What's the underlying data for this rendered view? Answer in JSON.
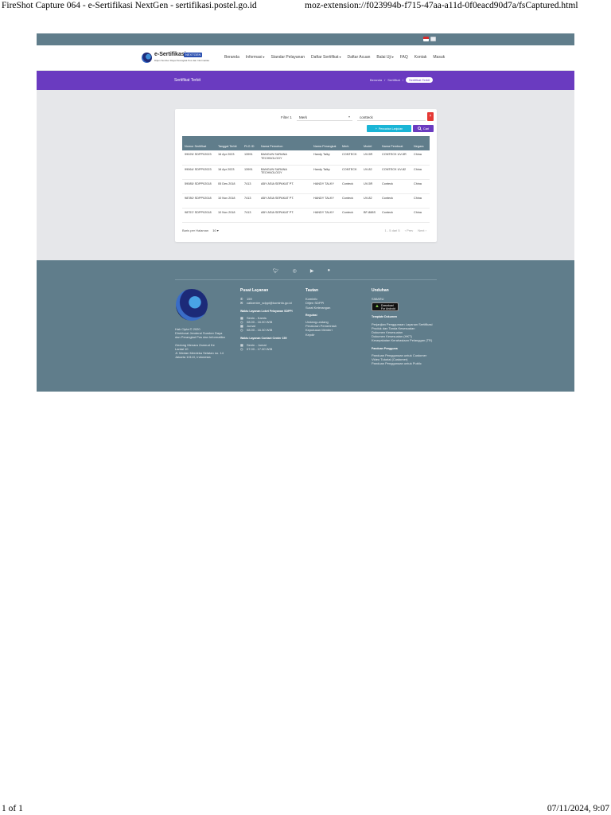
{
  "print_header": {
    "left": "FireShot Capture 064 - e-Sertifikasi NextGen - sertifikasi.postel.go.id",
    "right": "moz-extension://f023994b-f715-47aa-a11d-0f0eacd90d7a/fsCaptured.html"
  },
  "print_footer": {
    "left": "1 of 1",
    "right": "07/11/2024, 9:07"
  },
  "logo": {
    "title": "e-Sertifikasi",
    "badge": "NEXTGEN",
    "subtitle": "Ditjen Sumber Daya Perangkat Pos dan Informatika"
  },
  "nav": {
    "items": [
      {
        "label": "Beranda"
      },
      {
        "label": "Informasi",
        "dropdown": true
      },
      {
        "label": "Standar Pelayanan"
      },
      {
        "label": "Daftar Sertifikat",
        "dropdown": true
      },
      {
        "label": "Daftar Acuan"
      },
      {
        "label": "Balai Uji",
        "dropdown": true
      },
      {
        "label": "FAQ"
      },
      {
        "label": "Kontak"
      },
      {
        "label": "Masuk"
      }
    ]
  },
  "banner": {
    "title": "Sertifikat Terbit",
    "breadcrumbs": [
      "Beranda",
      "Sertifikat",
      "Sertifikat Terbit"
    ],
    "separator": "/"
  },
  "filter": {
    "label": "Filter 1",
    "field": "Merk",
    "search_value": "contteck",
    "clear_label": "×",
    "advanced_label": "Pencarian Lanjutan",
    "search_label": "Cari"
  },
  "table": {
    "headers": [
      "Nomor Sertifikat",
      "Tanggal Terbit",
      "PLG ID",
      "Nama Pemohon",
      "Nama Perangkat",
      "Merk",
      "Model",
      "Nama Pembuat",
      "Negara"
    ],
    "rows": [
      [
        "99025/ SDPPI/2023",
        "16 Apr 2023",
        "13991",
        "BANGUN SARANA TECHNOLOGY",
        "Handy Talky",
        "CONTECK",
        "UV-5R",
        "CONTECK UV-5R",
        "China"
      ],
      [
        "99064/ SDPPI/2023",
        "16 Apr 2023",
        "13991",
        "BANGUN SARANA TECHNOLOGY",
        "Handy Talky",
        "CONTECK",
        "UV-82",
        "CONTECK UV-82",
        "China"
      ],
      [
        "59085/ SDPPI/2018",
        "05 Des 2018",
        "7413",
        "ABY ASIA SEPAKAT PT.",
        "HANDY TALKY",
        "Conteck",
        "UV-5R",
        "Conteck",
        "China"
      ],
      [
        "98780/ SDPPI/2018",
        "10 Nov 2018",
        "7413",
        "ABY ASIA SEPAKAT PT.",
        "HANDY TALKY",
        "Conteck",
        "UV-82",
        "Conteck",
        "China"
      ],
      [
        "98757/ SDPPI/2018",
        "10 Nov 2018",
        "7413",
        "ABY ASIA SEPAKAT PT.",
        "HANDY TALKY",
        "Conteck",
        "BF-888S",
        "Conteck",
        "China"
      ]
    ]
  },
  "pagination": {
    "rows_per_page_label": "Baris per Halaman",
    "rows_per_page_value": "10",
    "range": "1 - 5 dari 5",
    "prev": "Prev",
    "next": "Next"
  },
  "footer": {
    "left_lines": [
      "Hak Cipta © 2020",
      "Direktorat Jenderal Sumber Daya",
      "dan Perangkat Pos dan Informatika",
      "",
      "Gedung Menara Zamrud Ke",
      "Lantai 10",
      "Jl. Medan Merdeka Selatan no. 14",
      "Jakarta 10110, Indonesia"
    ],
    "pusat": {
      "title": "Pusat Layanan",
      "phone": "159",
      "email": "callcenter_sdppi@kominfo.go.id",
      "walk_in_title": "Waktu Layanan Loket Pelayanan SDPPI",
      "walk_in_days_1": "Senin - Kamis",
      "walk_in_hours_1": "08.00 - 16.00 WIB",
      "walk_in_days_2": "Jumat",
      "walk_in_hours_2": "08.00 - 16.30 WIB",
      "call_title": "Waktu Layanan Contact Center 159",
      "call_days": "Senin - Jumat",
      "call_hours": "07.00 - 17.00 WIB"
    },
    "tautan": {
      "title": "Tautan",
      "links": [
        "Kominfo",
        "Ditjen SDPPI",
        "Surat Keterangan"
      ],
      "regulasi_title": "Regulasi",
      "regulasi_links": [
        "Undang-undang",
        "Peraturan Pemerintah",
        "Keputusan Menteri",
        "Kepdir"
      ]
    },
    "unduhan": {
      "title": "Unduhan",
      "app_label": "SIMARU",
      "store_line1": "Download",
      "store_line2": "For Android",
      "template_title": "Template Dokumen",
      "template_links": [
        "Perjanjian Penggunaan Layanan Sertifikasi",
        "Produk dan Tanda Kesesuaian",
        "Dokumen Kesesuaian",
        "Dokumen Kesesuaian (HKT)",
        "Kesepakatan Kerahasiaan Pelanggan (TR)"
      ],
      "guide_title": "Panduan Pengguna",
      "guide_links": [
        "Panduan Penggunaan untuk Customer",
        "Video Tutorial (Customer)",
        "Panduan Penggunaan untuk Public"
      ]
    }
  },
  "colors": {
    "purple": "#6a3bc0",
    "slate": "#607d8b",
    "cyan": "#1ab5d6",
    "red": "#e53935"
  }
}
